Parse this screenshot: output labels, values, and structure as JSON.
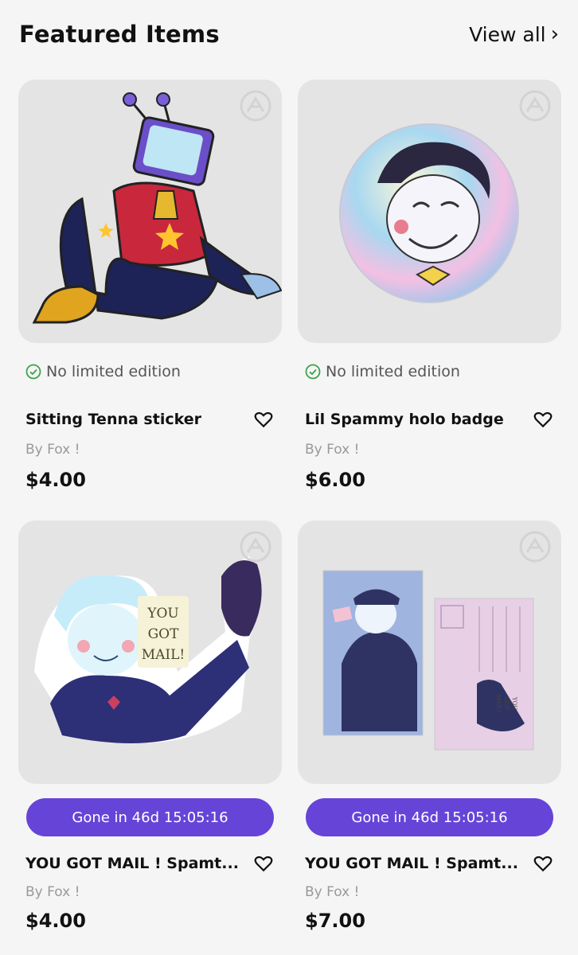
{
  "header": {
    "title": "Featured Items",
    "view_all_label": "View all",
    "view_all_chevron": "›"
  },
  "colors": {
    "accent": "#6644d8",
    "badge_check": "#3aa34a",
    "background": "#f5f5f5",
    "card_bg": "#e4e4e4"
  },
  "items": [
    {
      "badge": "No limited edition",
      "title": "Sitting Tenna sticker",
      "seller": "By Fox !",
      "price": "$4.00",
      "image": "tv-head-character-sticker"
    },
    {
      "badge": "No limited edition",
      "title": "Lil Spammy holo badge",
      "seller": "By Fox !",
      "price": "$6.00",
      "image": "holo-badge-character"
    },
    {
      "timer": "Gone in 46d 15:05:16",
      "title": "YOU GOT MAIL ! Spamt...",
      "seller": "By Fox !",
      "price": "$4.00",
      "image": "mail-character-sticker",
      "image_text": [
        "YOU",
        "GOT",
        "MAIL!"
      ]
    },
    {
      "timer": "Gone in 46d 15:05:16",
      "title": "YOU GOT MAIL ! Spamt...",
      "seller": "By Fox !",
      "price": "$7.00",
      "image": "postcard-set",
      "image_text": [
        "YOU",
        "GOT",
        "MAIL!"
      ]
    }
  ]
}
